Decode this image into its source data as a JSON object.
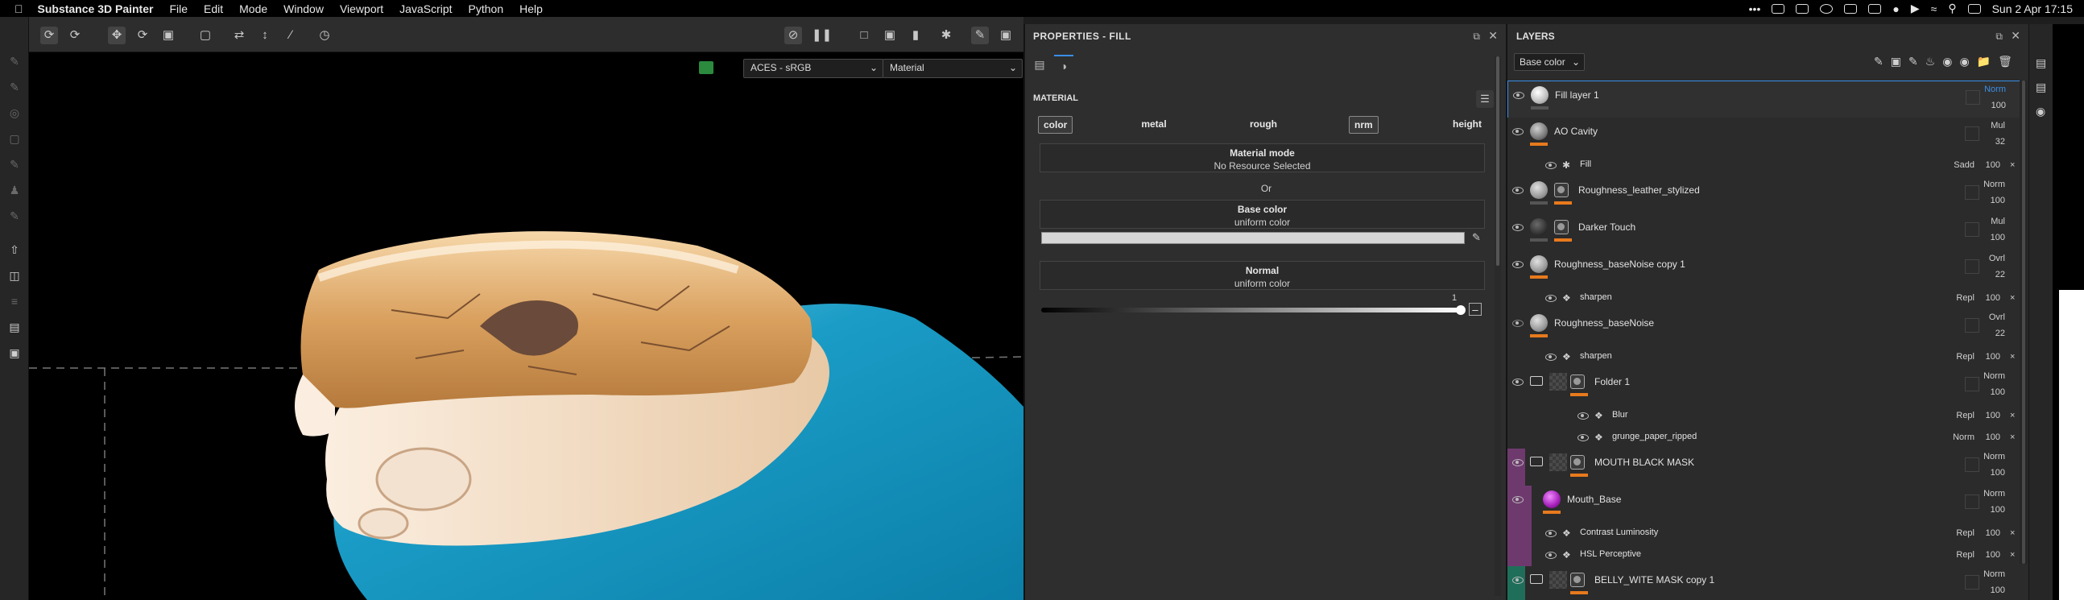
{
  "menubar": {
    "app_name": "Substance 3D Painter",
    "menus": [
      "File",
      "Edit",
      "Mode",
      "Window",
      "Viewport",
      "JavaScript",
      "Python",
      "Help"
    ],
    "clock": "Sun 2 Apr  17:15"
  },
  "viewport": {
    "colorspace": "ACES - sRGB",
    "display_mode": "Material"
  },
  "properties": {
    "title": "PROPERTIES - FILL",
    "section": "MATERIAL",
    "channels": [
      "color",
      "metal",
      "rough",
      "nrm",
      "height"
    ],
    "active_channels": [
      "color",
      "nrm"
    ],
    "material_mode_label": "Material mode",
    "material_mode_value": "No Resource Selected",
    "or_label": "Or",
    "base_color_label": "Base color",
    "base_color_value": "uniform color",
    "normal_label": "Normal",
    "normal_value": "uniform color",
    "slider_value": "1",
    "slider_level": 1.0
  },
  "layers": {
    "title": "LAYERS",
    "channel_select": "Base color",
    "rows": [
      {
        "name": "Fill layer 1",
        "blend": "Norm",
        "opacity": "100",
        "thumb": "white",
        "indent": 0,
        "selected": true
      },
      {
        "name": "AO Cavity",
        "blend": "Mul",
        "opacity": "32",
        "thumb": "ao",
        "indent": 0
      },
      {
        "name": "Fill",
        "blend": "Sadd",
        "opacity": "100",
        "thumb": "none",
        "indent": 1,
        "sub": true
      },
      {
        "name": "Roughness_leather_stylized",
        "blend": "Norm",
        "opacity": "100",
        "thumb": "grey",
        "mask": true,
        "indent": 0
      },
      {
        "name": "Darker Touch",
        "blend": "Mul",
        "opacity": "100",
        "thumb": "dark",
        "mask": true,
        "indent": 0
      },
      {
        "name": "Roughness_baseNoise copy 1",
        "blend": "Ovrl",
        "opacity": "22",
        "thumb": "grey",
        "indent": 0
      },
      {
        "name": "sharpen",
        "blend": "Repl",
        "opacity": "100",
        "indent": 1,
        "sub": true
      },
      {
        "name": "Roughness_baseNoise",
        "blend": "Ovrl",
        "opacity": "22",
        "thumb": "grey",
        "indent": 0,
        "hidden": true
      },
      {
        "name": "sharpen",
        "blend": "Repl",
        "opacity": "100",
        "indent": 1,
        "sub": true
      },
      {
        "name": "Folder 1",
        "blend": "Norm",
        "opacity": "100",
        "folder": true,
        "mask": true,
        "indent": 0
      },
      {
        "name": "Blur",
        "blend": "Repl",
        "opacity": "100",
        "indent": 2,
        "sub": true
      },
      {
        "name": "grunge_paper_ripped",
        "blend": "Norm",
        "opacity": "100",
        "indent": 2,
        "sub": true
      },
      {
        "name": "MOUTH BLACK MASK",
        "blend": "Norm",
        "opacity": "100",
        "folder": true,
        "mask": true,
        "indent": 0,
        "tint": "purple"
      },
      {
        "name": "Mouth_Base",
        "blend": "Norm",
        "opacity": "100",
        "thumb": "purple",
        "indent": 1,
        "tint": "purple"
      },
      {
        "name": "Contrast Luminosity",
        "blend": "Repl",
        "opacity": "100",
        "indent": 1,
        "sub": true,
        "tint": "purple"
      },
      {
        "name": "HSL Perceptive",
        "blend": "Repl",
        "opacity": "100",
        "indent": 1,
        "sub": true,
        "tint": "purple"
      },
      {
        "name": "BELLY_WITE MASK copy 1",
        "blend": "Norm",
        "opacity": "100",
        "folder": true,
        "mask": true,
        "indent": 0,
        "tint": "teal"
      }
    ]
  },
  "colors": {
    "accent_orange": "#e87a1d",
    "selection_blue": "#3a8ee6",
    "purple_tint": "#6e3a6e",
    "teal_tint": "#1f6e5a"
  }
}
